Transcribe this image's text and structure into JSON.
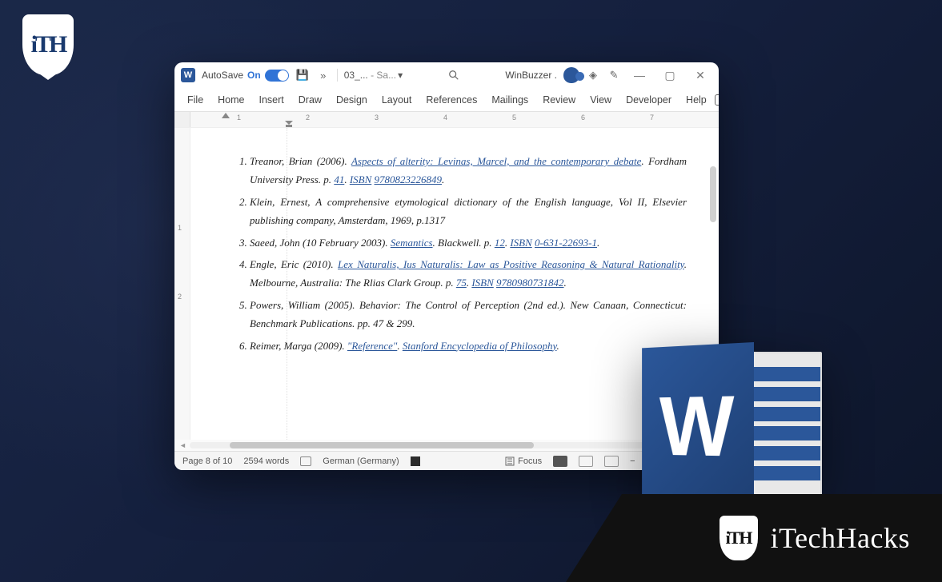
{
  "logo_tl": "iTH",
  "brand_br": {
    "logo": "iTH",
    "text": "iTechHacks"
  },
  "titlebar": {
    "autosave_label": "AutoSave",
    "autosave_state": "On",
    "filename": "03_...",
    "filename_suffix": "- Sa...",
    "account": "WinBuzzer ."
  },
  "ribbon": [
    "File",
    "Home",
    "Insert",
    "Draw",
    "Design",
    "Layout",
    "References",
    "Mailings",
    "Review",
    "View",
    "Developer",
    "Help"
  ],
  "ruler_numbers": [
    "1",
    "2",
    "3",
    "4",
    "5",
    "6",
    "7"
  ],
  "vruler_numbers": [
    "1",
    "2"
  ],
  "references": [
    {
      "plain_start": "Treanor, Brian (2006). ",
      "link1": "Aspects of alterity: Levinas, Marcel, and the contemporary debate",
      "mid": ". Fordham University Press. p. ",
      "page": "41",
      "mid2": ". ",
      "isbn_label": "ISBN",
      "space": " ",
      "isbn": "9780823226849",
      "end": "."
    },
    {
      "plain_start": "Klein, Ernest, ",
      "ital": "A comprehensive etymological dictionary of the English language",
      "mid": ", Vol II, Elsevier publishing company, Amsterdam, 1969, p.1317"
    },
    {
      "plain_start": "Saeed, John (10 February 2003). ",
      "link1": "Semantics",
      "mid": ". Blackwell. p. ",
      "page": "12",
      "mid2": ". ",
      "isbn_label": "ISBN",
      "space": " ",
      "isbn": "0-631-22693-1",
      "end": "."
    },
    {
      "plain_start": "Engle, Eric (2010). ",
      "link1": "Lex Naturalis, Ius Naturalis: Law as Positive Reasoning & Natural Rationality",
      "mid": ". Melbourne, Australia: The Rlias Clark Group. p. ",
      "page": "75",
      "mid2": ". ",
      "isbn_label": "ISBN",
      "space": " ",
      "isbn": "9780980731842",
      "end": "."
    },
    {
      "plain_start": "Powers, William (2005). Behavior: The Control of Perception (2nd ed.). New Canaan, Connecticut: Benchmark Publications. pp. 47 & 299."
    },
    {
      "plain_start": "Reimer, Marga (2009). ",
      "link1": "\"Reference\"",
      "mid": ". ",
      "link2": "Stanford Encyclopedia of Philosophy",
      "end": "."
    }
  ],
  "statusbar": {
    "page": "Page 8 of 10",
    "words": "2594 words",
    "lang": "German (Germany)",
    "focus": "Focus",
    "zoom_minus": "−",
    "zoom_plus": "+"
  },
  "word_logo_letter": "W"
}
